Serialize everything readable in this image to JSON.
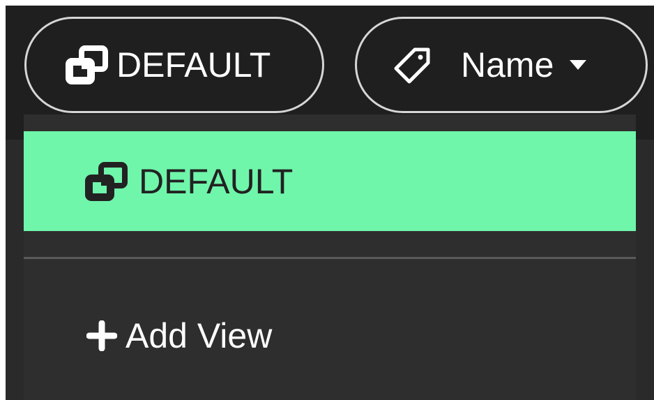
{
  "toolbar": {
    "view_selector": {
      "label": "DEFAULT",
      "icon": "views-icon"
    },
    "sort_selector": {
      "label": "Name",
      "icon": "tag-icon",
      "caret_icon": "caret-down-icon"
    }
  },
  "dropdown": {
    "options": [
      {
        "label": "DEFAULT",
        "icon": "views-icon",
        "selected": true
      }
    ],
    "add_view": {
      "label": "Add View",
      "icon": "plus-icon"
    }
  },
  "colors": {
    "selected_background": "#6ff6aa",
    "toolbar_background": "#1f1f1f",
    "menu_background": "#2e2e2e",
    "pill_border": "#d6d6d6"
  }
}
